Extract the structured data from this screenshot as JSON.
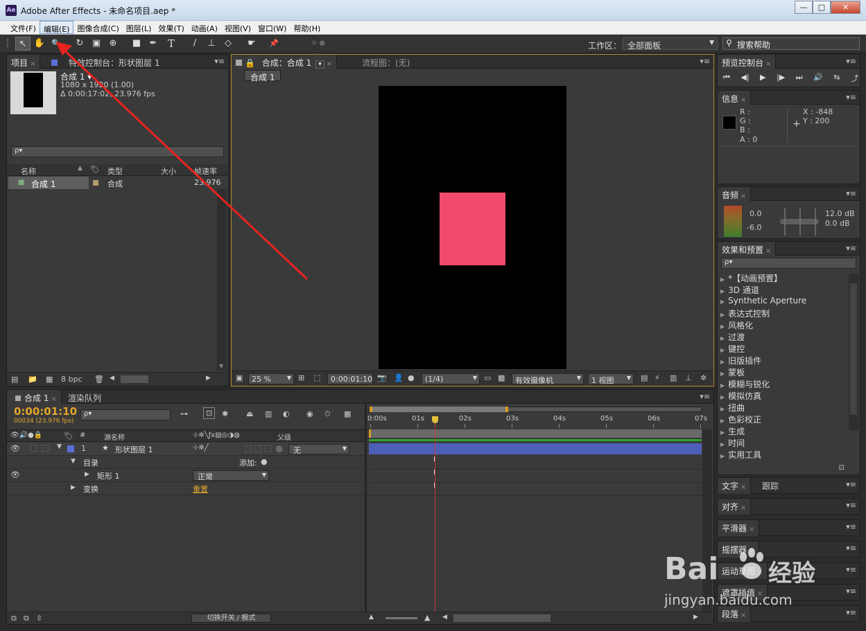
{
  "window": {
    "app_icon": "Ae",
    "title": "Adobe After Effects - 未命名项目.aep *",
    "buttons": {
      "minimize": "—",
      "maximize": "□",
      "close": "✕"
    }
  },
  "menu": [
    "文件(F)",
    "编辑(E)",
    "图像合成(C)",
    "图层(L)",
    "效果(T)",
    "动画(A)",
    "视图(V)",
    "窗口(W)",
    "帮助(H)"
  ],
  "toolbar": {
    "tools": [
      "selection-tool",
      "hand-tool",
      "zoom-tool",
      "rotate-tool",
      "camera-tool",
      "pan-behind-tool",
      "rectangle-tool",
      "pen-tool",
      "text-tool",
      "brush-tool",
      "clone-stamp-tool",
      "eraser-tool",
      "roto-brush-tool",
      "puppet-pin-tool"
    ],
    "tool_glyphs": [
      "↖",
      "✋",
      "🔍",
      "↻",
      "▣",
      "⊕",
      "■",
      "✒",
      "T",
      "/",
      "⊥",
      "◇",
      "☛",
      "📌"
    ],
    "workspace_label": "工作区：",
    "workspace_value": "全部面板",
    "help_search": "搜索帮助"
  },
  "project_panel": {
    "tabs": [
      "项目",
      "特效控制台：形状图层 1"
    ],
    "comp_name": "合成 1 ▾",
    "comp_size": "1080 x 1920 (1.00)",
    "comp_duration": "Δ 0:00:17:02, 23.976 fps",
    "search_placeholder": "ρ▾",
    "columns": [
      "名称",
      "类型",
      "大小",
      "帧速率"
    ],
    "items": [
      {
        "name": "合成 1",
        "type": "合成",
        "fps": "23.976"
      }
    ],
    "footer_bpc": "8 bpc"
  },
  "composition_panel": {
    "tabs": [
      "合成：合成 1",
      "流程图：(无)"
    ],
    "breadcrumb": "合成 1",
    "zoom": "25 %",
    "timecode": "0:00:01:10",
    "resolution": "(1/4)",
    "camera": "有效摄像机",
    "views": "1 视图",
    "shape_color": "#f14a6d"
  },
  "right_panels": {
    "preview": "预览控制台",
    "preview_buttons": [
      "⏮",
      "◀|",
      "▶",
      "|▶",
      "⏭",
      "🔊",
      "⇆",
      "⤴"
    ],
    "info": {
      "title": "信息",
      "R": "R :",
      "G": "G :",
      "B": "B :",
      "A": "A : 0",
      "X": "X : -848",
      "Y": "Y : 200"
    },
    "audio": {
      "title": "音频",
      "v1": "0.0",
      "v2": "-6.0",
      "db1": "12.0 dB",
      "db2": "0.0 dB"
    },
    "effects": {
      "title": "效果和预置",
      "search": "ρ▾",
      "items": [
        "*【动画预置】",
        "3D 通道",
        "Synthetic Aperture",
        "表达式控制",
        "风格化",
        "过渡",
        "键控",
        "旧版插件",
        "蒙板",
        "模糊与锐化",
        "模拟仿真",
        "扭曲",
        "色彩校正",
        "生成",
        "时间",
        "实用工具"
      ]
    },
    "text_tab": "文字",
    "track_tab": "跟踪",
    "align": "对齐",
    "smoother": "平滑器",
    "wiggler": "摇摆器",
    "motion_sketch": "运动草图",
    "mask_interp": "遮罩插值",
    "paragraph": "段落"
  },
  "timeline": {
    "tabs": [
      "合成 1",
      "渲染队列"
    ],
    "timecode": "0:00:01:10",
    "frame_info": "00034 (23.976 fps)",
    "search": "ρ▾",
    "columns": [
      "#",
      "源名称",
      "父级"
    ],
    "layer": {
      "num": "1",
      "name": "形状图层 1",
      "parent": "无"
    },
    "contents": "目录",
    "add": "添加:",
    "rect": "矩形 1",
    "blend": "正常",
    "transform": "变换",
    "reset": "重置",
    "ruler": [
      "0:00s",
      "01s",
      "02s",
      "03s",
      "04s",
      "05s",
      "06s",
      "07s"
    ],
    "toggle": "切换开关 / 模式"
  },
  "watermark": {
    "brand": "Bai",
    "brand2": "经验",
    "url": "jingyan.baidu.com"
  }
}
